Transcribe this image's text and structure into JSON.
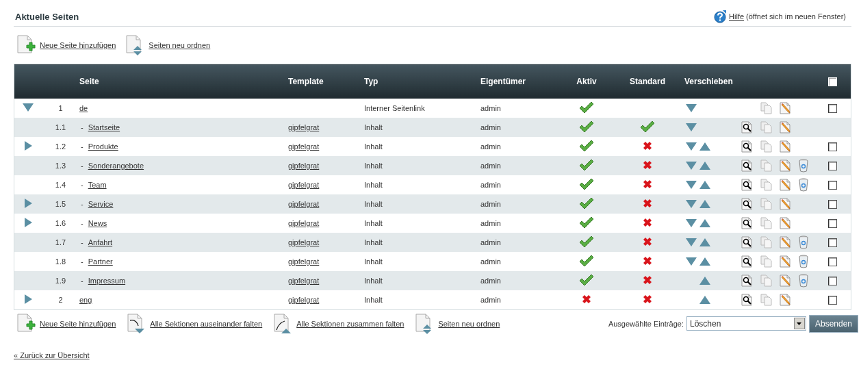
{
  "title": "Aktuelle Seiten",
  "help": {
    "link": "Hilfe",
    "note": "(öffnet sich im neuen Fenster)"
  },
  "top_actions": [
    {
      "kind": "add",
      "label": "Neue Seite hinzufügen"
    },
    {
      "kind": "reorder",
      "label": "Seiten neu ordnen"
    }
  ],
  "table": {
    "columns": [
      "Seite",
      "Template",
      "Typ",
      "Eigentümer",
      "Aktiv",
      "Standard",
      "Verschieben"
    ],
    "select_all": {
      "checked": false
    },
    "rows": [
      {
        "expandable": true,
        "expanded": true,
        "number": "1",
        "name": "de",
        "type": "Interner Seitenlink",
        "owner": "admin",
        "active": true,
        "move_down": true,
        "move_up": false,
        "preview": false,
        "delete": false,
        "checked": false,
        "children": [
          {
            "expandable": false,
            "number": "1.1",
            "prefix": "-",
            "name": "Startseite",
            "template": "gipfelgrat",
            "type": "Inhalt",
            "owner": "admin",
            "active": true,
            "standard": true,
            "move_down": true,
            "move_up": false,
            "preview": true,
            "delete": false
          },
          {
            "expandable": true,
            "expanded": false,
            "number": "1.2",
            "prefix": "-",
            "name": "Produkte",
            "template": "gipfelgrat",
            "type": "Inhalt",
            "owner": "admin",
            "active": true,
            "standard": false,
            "move_down": true,
            "move_up": true,
            "preview": true,
            "delete": false,
            "checked": false
          },
          {
            "expandable": false,
            "number": "1.3",
            "prefix": "-",
            "name": "Sonderangebote",
            "template": "gipfelgrat",
            "type": "Inhalt",
            "owner": "admin",
            "active": true,
            "standard": false,
            "move_down": true,
            "move_up": true,
            "preview": true,
            "delete": true,
            "checked": false
          },
          {
            "expandable": false,
            "number": "1.4",
            "prefix": "-",
            "name": "Team",
            "template": "gipfelgrat",
            "type": "Inhalt",
            "owner": "admin",
            "active": true,
            "standard": false,
            "move_down": true,
            "move_up": true,
            "preview": true,
            "delete": true,
            "checked": false
          },
          {
            "expandable": true,
            "expanded": false,
            "number": "1.5",
            "prefix": "-",
            "name": "Service",
            "template": "gipfelgrat",
            "type": "Inhalt",
            "owner": "admin",
            "active": true,
            "standard": false,
            "move_down": true,
            "move_up": true,
            "preview": true,
            "delete": false,
            "checked": false
          },
          {
            "expandable": true,
            "expanded": false,
            "number": "1.6",
            "prefix": "-",
            "name": "News",
            "template": "gipfelgrat",
            "type": "Inhalt",
            "owner": "admin",
            "active": true,
            "standard": false,
            "move_down": true,
            "move_up": true,
            "preview": true,
            "delete": false,
            "checked": false
          },
          {
            "expandable": false,
            "number": "1.7",
            "prefix": "-",
            "name": "Anfahrt",
            "template": "gipfelgrat",
            "type": "Inhalt",
            "owner": "admin",
            "active": true,
            "standard": false,
            "move_down": true,
            "move_up": true,
            "preview": true,
            "delete": true,
            "checked": false
          },
          {
            "expandable": false,
            "number": "1.8",
            "prefix": "-",
            "name": "Partner",
            "template": "gipfelgrat",
            "type": "Inhalt",
            "owner": "admin",
            "active": true,
            "standard": false,
            "move_down": true,
            "move_up": true,
            "preview": true,
            "delete": true,
            "checked": false
          },
          {
            "expandable": false,
            "number": "1.9",
            "prefix": "-",
            "name": "Impressum",
            "template": "gipfelgrat",
            "type": "Inhalt",
            "owner": "admin",
            "active": true,
            "standard": false,
            "move_down": false,
            "move_up": true,
            "preview": true,
            "delete": true,
            "checked": false
          }
        ]
      },
      {
        "expandable": true,
        "expanded": false,
        "number": "2",
        "name": "eng",
        "template": "gipfelgrat",
        "type": "Inhalt",
        "owner": "admin",
        "active": false,
        "standard": false,
        "move_down": false,
        "move_up": true,
        "preview": true,
        "delete": false,
        "checked": false
      }
    ]
  },
  "bottom_actions": [
    {
      "kind": "add",
      "label": "Neue Seite hinzufügen"
    },
    {
      "kind": "expand",
      "label": "Alle Sektionen auseinander falten"
    },
    {
      "kind": "collapse",
      "label": "Alle Sektionen zusammen falten"
    },
    {
      "kind": "reorder",
      "label": "Seiten neu ordnen"
    }
  ],
  "bulk": {
    "label": "Ausgewählte Einträge:",
    "value": "Löschen",
    "button": "Absenden"
  },
  "back_link": "« Zurück zur Übersicht"
}
